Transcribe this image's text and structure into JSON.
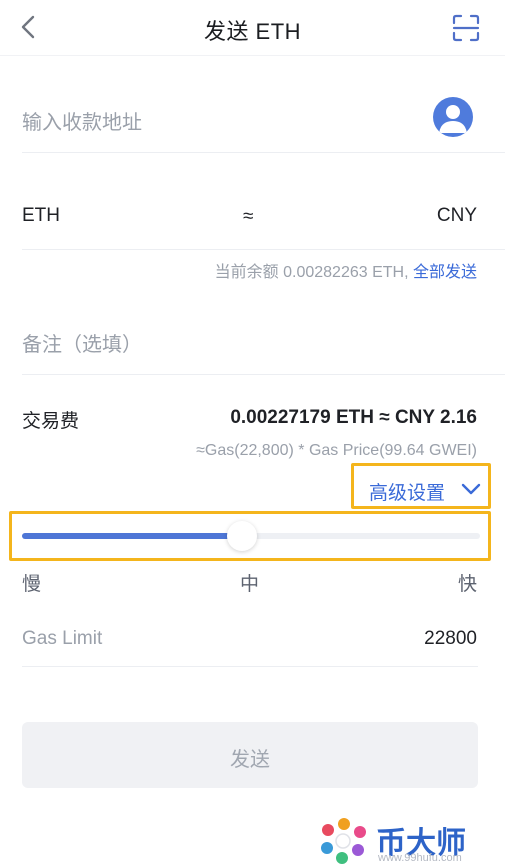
{
  "header": {
    "title": "发送 ETH",
    "back_icon": "chevron-left-icon",
    "scan_icon": "scan-icon"
  },
  "address": {
    "placeholder": "输入收款地址",
    "contact_icon": "contact-avatar-icon"
  },
  "amount": {
    "eth_label": "ETH",
    "approx": "≈",
    "cny_label": "CNY"
  },
  "balance": {
    "text": "当前余额 0.00282263 ETH,",
    "send_all": "全部发送"
  },
  "memo": {
    "placeholder": "备注（选填）"
  },
  "fee": {
    "label": "交易费",
    "value": "0.00227179 ETH ≈ CNY 2.16",
    "formula": "≈Gas(22,800) * Gas Price(99.64 GWEI)"
  },
  "advanced": {
    "label": "高级设置",
    "icon": "chevron-down-icon"
  },
  "slider": {
    "level": 0.48,
    "slow": "慢",
    "medium": "中",
    "fast": "快"
  },
  "gas_limit": {
    "label": "Gas Limit",
    "value": "22800"
  },
  "send_button": {
    "label": "发送"
  },
  "watermark": {
    "text": "币大师",
    "url": "www.99hufu.com"
  },
  "colors": {
    "accent": "#3a6ad8",
    "slider_fill": "#4e76d6",
    "highlight": "#f4b51c",
    "placeholder": "#9aa0aa"
  }
}
